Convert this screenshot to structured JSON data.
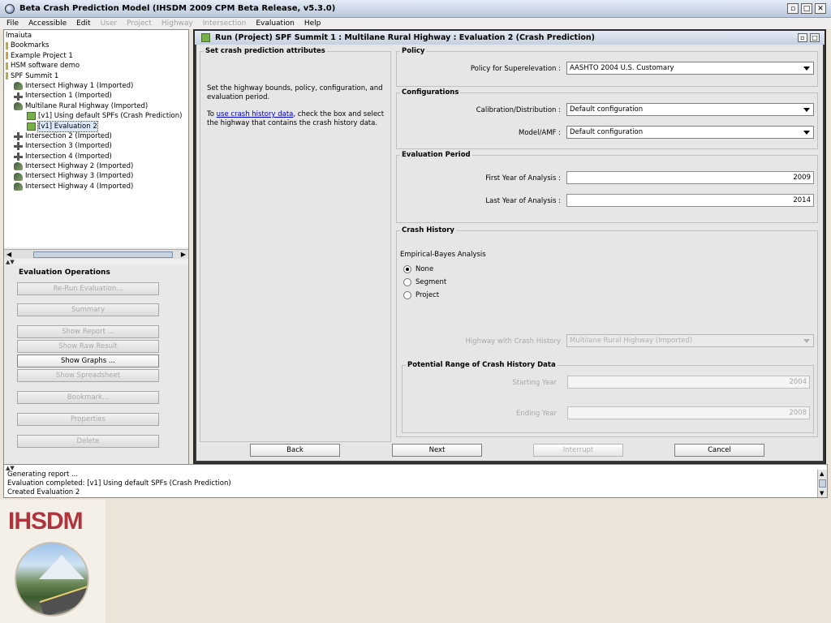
{
  "window": {
    "title": "Beta Crash Prediction Model (IHSDM 2009 CPM Beta Release, v5.3.0)"
  },
  "menu": [
    {
      "label": "File",
      "enabled": true
    },
    {
      "label": "Accessible",
      "enabled": true
    },
    {
      "label": "Edit",
      "enabled": true
    },
    {
      "label": "User",
      "enabled": false
    },
    {
      "label": "Project",
      "enabled": false
    },
    {
      "label": "Highway",
      "enabled": false
    },
    {
      "label": "Intersection",
      "enabled": false
    },
    {
      "label": "Evaluation",
      "enabled": true
    },
    {
      "label": "Help",
      "enabled": true
    }
  ],
  "tree": {
    "items": [
      {
        "label": "lmaiuta",
        "icon": "none",
        "indent": 0
      },
      {
        "label": "Bookmarks",
        "icon": "folder",
        "indent": 0
      },
      {
        "label": "Example Project 1",
        "icon": "folder",
        "indent": 0
      },
      {
        "label": "HSM software demo",
        "icon": "folder",
        "indent": 0
      },
      {
        "label": "SPF Summit 1",
        "icon": "folder",
        "indent": 0
      },
      {
        "label": "Intersect Highway 1 (Imported)",
        "icon": "highway",
        "indent": 1
      },
      {
        "label": "Intersection 1 (Imported)",
        "icon": "intersection",
        "indent": 1
      },
      {
        "label": "Multilane Rural Highway (Imported)",
        "icon": "highway",
        "indent": 1
      },
      {
        "label": "[v1] Using default SPFs (Crash Prediction)",
        "icon": "evaluation",
        "indent": 2
      },
      {
        "label": "[v1] Evaluation 2",
        "icon": "evaluation",
        "indent": 2,
        "selected": true
      },
      {
        "label": "Intersection 2 (Imported)",
        "icon": "intersection",
        "indent": 1
      },
      {
        "label": "Intersection 3 (Imported)",
        "icon": "intersection",
        "indent": 1
      },
      {
        "label": "Intersection 4 (Imported)",
        "icon": "intersection",
        "indent": 1
      },
      {
        "label": "Intersect Highway 2 (Imported)",
        "icon": "highway",
        "indent": 1
      },
      {
        "label": "Intersect Highway 3 (Imported)",
        "icon": "highway",
        "indent": 1
      },
      {
        "label": "Intersect Highway 4 (Imported)",
        "icon": "highway",
        "indent": 1
      }
    ]
  },
  "eval_ops": {
    "heading": "Evaluation Operations",
    "buttons": [
      {
        "label": "Re-Run Evaluation...",
        "enabled": false
      },
      {
        "label": "Summary",
        "enabled": false
      },
      {
        "label": "Show Report ...",
        "enabled": false
      },
      {
        "label": "Show Raw Result",
        "enabled": false
      },
      {
        "label": "Show Graphs ...",
        "enabled": true
      },
      {
        "label": "Show Spreadsheet",
        "enabled": false
      },
      {
        "label": "Bookmark...",
        "enabled": false
      },
      {
        "label": "Properties",
        "enabled": false
      },
      {
        "label": "Delete",
        "enabled": false
      }
    ]
  },
  "dialog": {
    "title": "Run (Project) SPF Summit 1 : Multilane Rural Highway : Evaluation 2 (Crash Prediction)",
    "left_panel": {
      "heading": "Set crash prediction attributes",
      "para1": "Set the highway bounds, policy, configuration, and evaluation period.",
      "para2_pre": "To ",
      "para2_link": "use crash history data",
      "para2_post": ", check the box and select the highway that contains the crash history data."
    },
    "policy": {
      "group_label": "Policy",
      "superelevation_label": "Policy for Superelevation :",
      "superelevation_value": "AASHTO 2004 U.S. Customary"
    },
    "configurations": {
      "group_label": "Configurations",
      "calibration_label": "Calibration/Distribution :",
      "calibration_value": "Default configuration",
      "model_label": "Model/AMF :",
      "model_value": "Default configuration"
    },
    "evaluation_period": {
      "group_label": "Evaluation Period",
      "first_label": "First Year of Analysis :",
      "first_value": "2009",
      "last_label": "Last Year of Analysis :",
      "last_value": "2014"
    },
    "crash_history": {
      "group_label": "Crash History",
      "eb_label": "Empirical-Bayes Analysis",
      "options": [
        {
          "label": "None",
          "selected": true
        },
        {
          "label": "Segment",
          "selected": false
        },
        {
          "label": "Project",
          "selected": false
        }
      ],
      "highway_label": "Highway with Crash History",
      "highway_value": "Multilane Rural Highway (Imported)",
      "range_label": "Potential Range of Crash History Data",
      "start_label": "Starting Year",
      "start_value": "2004",
      "end_label": "Ending Year",
      "end_value": "2008"
    },
    "buttons": {
      "back": "Back",
      "next": "Next",
      "interrupt": "Interrupt",
      "cancel": "Cancel"
    }
  },
  "status": {
    "lines": [
      "Generating report ...",
      "Evaluation completed: [v1] Using default SPFs (Crash Prediction)",
      "Created Evaluation 2"
    ]
  },
  "logo": {
    "text": "IHSDM"
  },
  "colors": {
    "logo_red": "#b0343c",
    "link_blue": "#0000cc",
    "selection": "#dde8f8"
  }
}
